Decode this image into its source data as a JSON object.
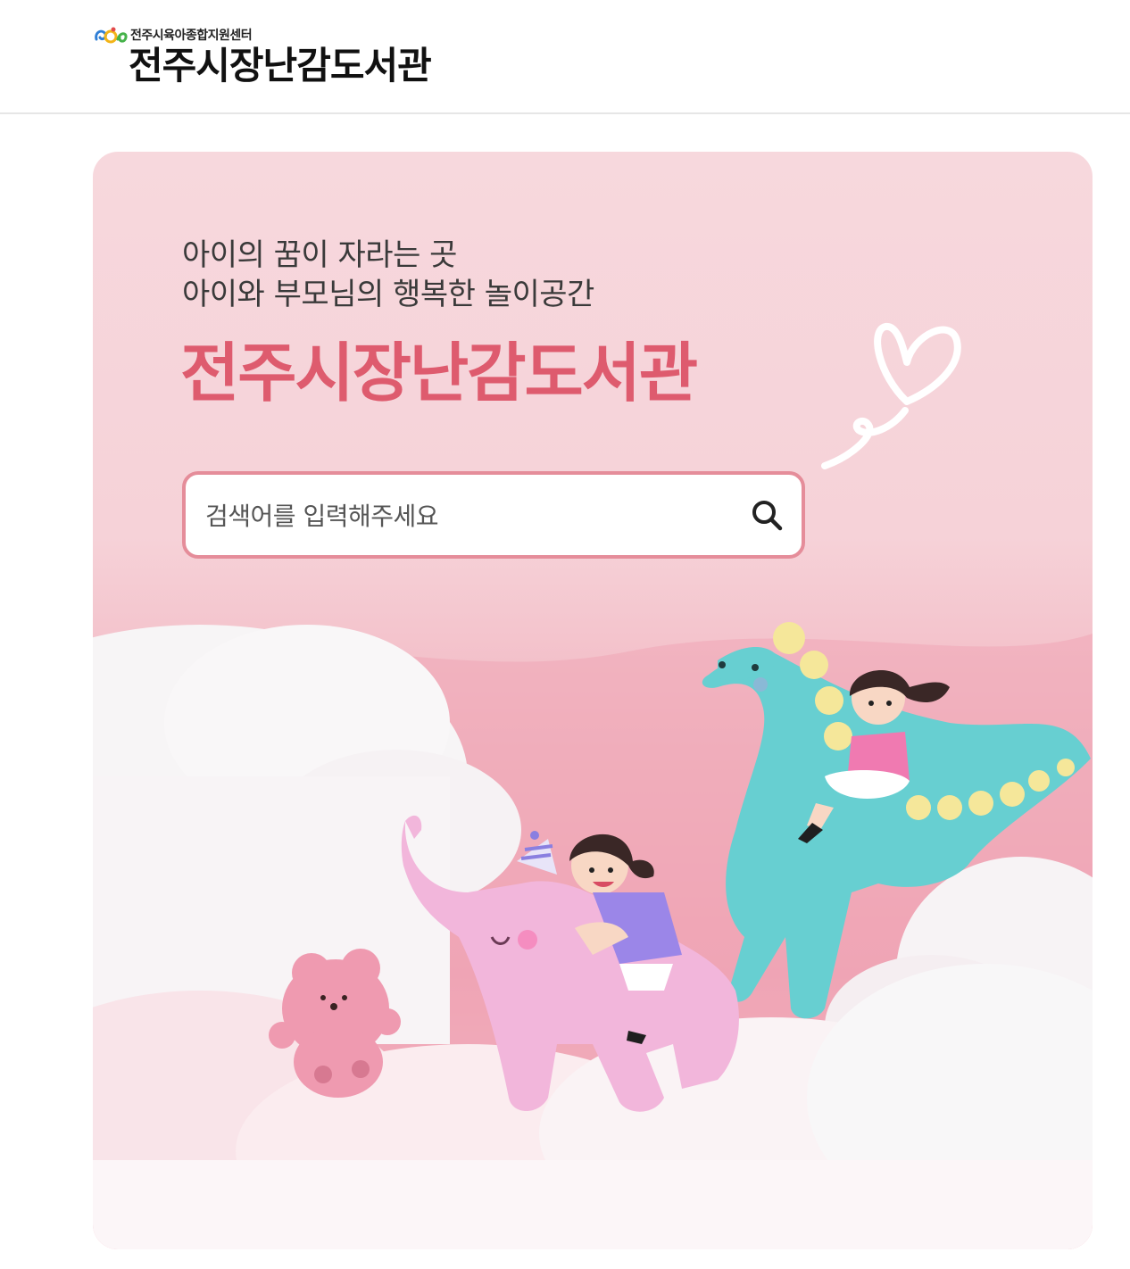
{
  "header": {
    "logo_subtitle": "전주시육아종합지원센터",
    "logo_title": "전주시장난감도서관"
  },
  "hero": {
    "tagline_line1": "아이의 꿈이 자라는 곳",
    "tagline_line2": "아이와 부모님의 행복한 놀이공간",
    "title": "전주시장난감도서관"
  },
  "search": {
    "placeholder": "검색어를 입력해주세요",
    "value": ""
  },
  "colors": {
    "accent": "#de5b6e",
    "search_border": "#e58d9a",
    "hero_background": "#f6d2d8"
  }
}
